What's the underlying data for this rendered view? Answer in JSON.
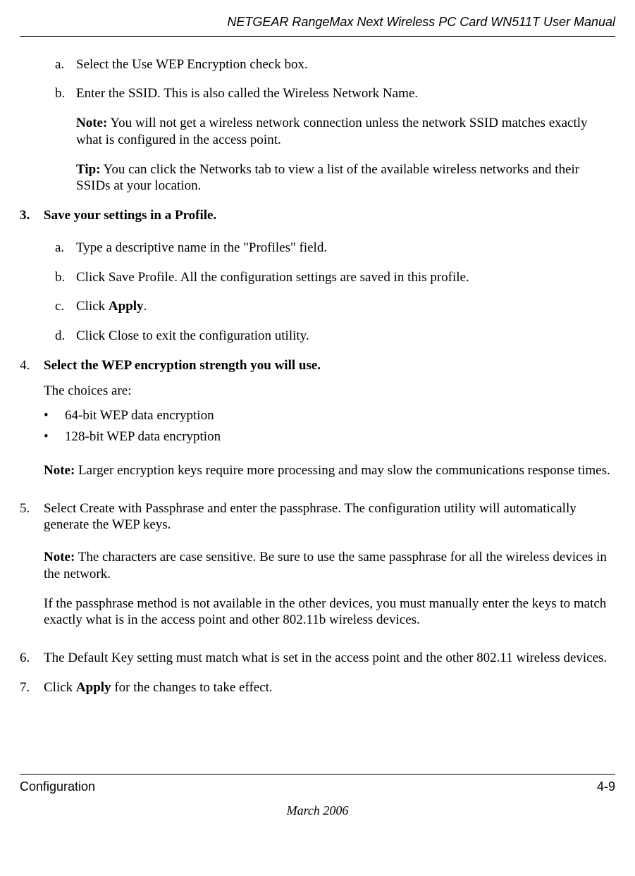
{
  "header": {
    "title": "NETGEAR RangeMax Next Wireless PC Card WN511T User Manual"
  },
  "body": {
    "step2ab": {
      "a_marker": "a.",
      "a_text": "Select the Use WEP Encryption check box.",
      "b_marker": "b.",
      "b_text": "Enter the SSID. This is also called the Wireless Network Name.",
      "note_label": "Note:",
      "note_text": " You will not get a wireless network connection unless the network SSID matches exactly what is configured in the access point.",
      "tip_label": "Tip:",
      "tip_text": " You can click the Networks tab to view a list of the available wireless networks and their SSIDs at your location."
    },
    "step3": {
      "marker": "3.",
      "title": "Save your settings in a Profile.",
      "a_marker": "a.",
      "a_text": "Type a descriptive name in the \"Profiles\" field.",
      "b_marker": "b.",
      "b_text": "Click Save Profile. All the configuration settings are saved in this profile.",
      "c_marker": "c.",
      "c_pre": "Click ",
      "c_bold": "Apply",
      "c_post": ".",
      "d_marker": "d.",
      "d_text": "Click Close to exit the configuration utility."
    },
    "step4": {
      "marker": "4.",
      "title": "Select the WEP encryption strength you will use.",
      "choices_text": "The choices are:",
      "bullet1_marker": "•",
      "bullet1_text": "64-bit WEP data encryption",
      "bullet2_marker": "•",
      "bullet2_text": "128-bit WEP data encryption",
      "note_label": "Note:",
      "note_text": " Larger encryption keys require more processing and may slow the communications response times."
    },
    "step5": {
      "marker": "5.",
      "text": "Select Create with Passphrase and enter the passphrase. The configuration utility will automatically generate the WEP keys.",
      "note_label": "Note:",
      "note_text": " The characters are case sensitive. Be sure to use the same passphrase for all the wireless devices in the network.",
      "extra_text": "If the passphrase method is not available in the other devices, you must manually enter the keys to match exactly what is in the access point and other 802.11b wireless devices."
    },
    "step6": {
      "marker": "6.",
      "text": "The Default Key setting must match what is set in the access point and the other 802.11 wireless devices."
    },
    "step7": {
      "marker": "7.",
      "pre": "Click ",
      "bold": "Apply",
      "post": " for the changes to take effect."
    }
  },
  "footer": {
    "section": "Configuration",
    "page": "4-9",
    "date": "March 2006"
  }
}
